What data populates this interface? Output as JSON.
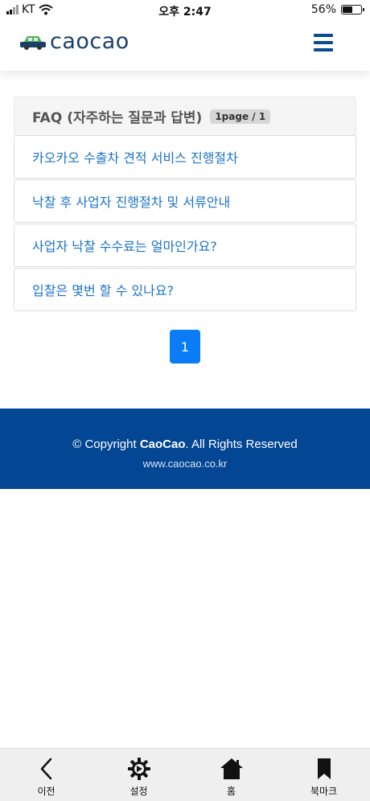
{
  "status_bar": {
    "carrier": "KT",
    "time": "오후 2:47",
    "battery_percent": "56%",
    "battery_level": 0.56,
    "icons": [
      "signal-icon",
      "wifi-icon",
      "battery-icon"
    ]
  },
  "header": {
    "logo_text": "caocao",
    "menu_icon": "hamburger-menu-icon",
    "brand_color": "#1a3f6b"
  },
  "faq": {
    "title": "FAQ (자주하는 질문과 답변)",
    "page_badge": "1page / 1",
    "items": [
      {
        "label": "카오카오 수출차 견적 서비스 진행절차"
      },
      {
        "label": "낙찰 후 사업자 진행절차 및 서류안내"
      },
      {
        "label": "사업자 낙찰 수수료는 얼마인가요?"
      },
      {
        "label": "입찰은 몇번 할 수 있나요?"
      }
    ],
    "link_color": "#1a73c9"
  },
  "pagination": {
    "current_page": "1",
    "active_color": "#0a7cf5"
  },
  "footer": {
    "copyright_prefix": "© Copyright ",
    "brand": "CaoCao",
    "copyright_suffix": ". All Rights Reserved",
    "url": "www.caocao.co.kr",
    "background": "#034693"
  },
  "tab_bar": {
    "tabs": [
      {
        "label": "이전",
        "icon": "back-chevron-icon"
      },
      {
        "label": "설정",
        "icon": "gear-icon"
      },
      {
        "label": "홈",
        "icon": "home-icon"
      },
      {
        "label": "북마크",
        "icon": "bookmark-icon"
      }
    ]
  }
}
